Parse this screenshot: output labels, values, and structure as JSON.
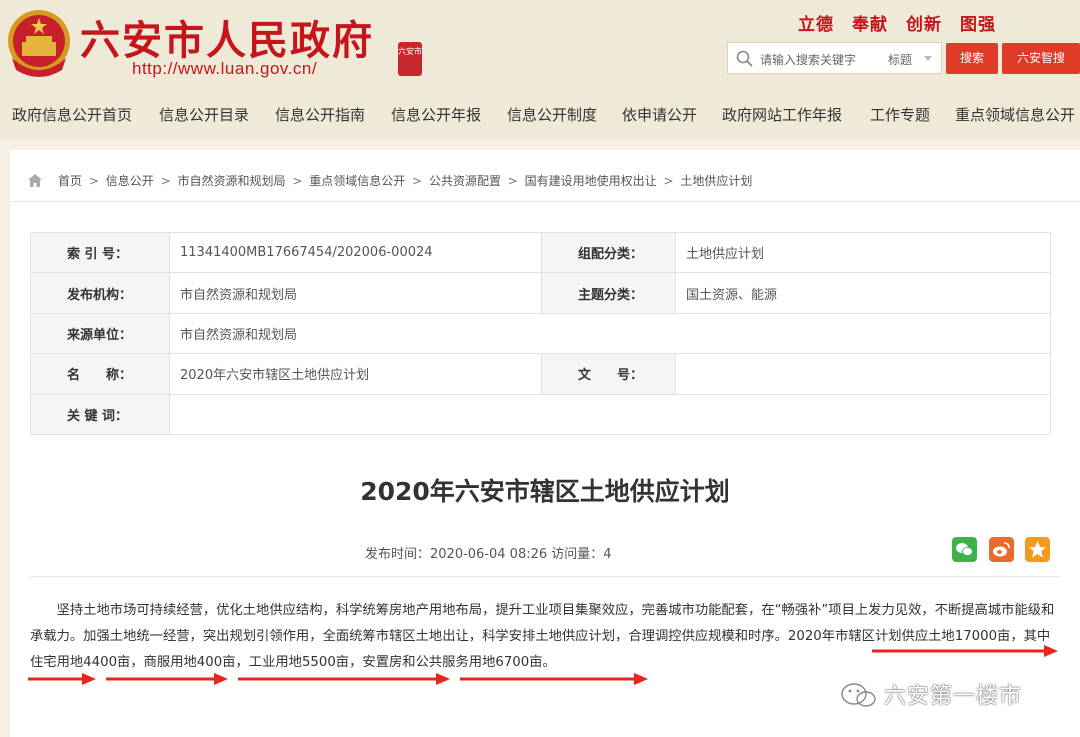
{
  "header": {
    "site_title": "六安市人民政府",
    "site_url": "http://www.luan.gov.cn/",
    "seal_text": "六安市",
    "slogan": "立德　奉献　创新　图强",
    "search": {
      "placeholder": "请输入搜索关键字",
      "scope": "标题",
      "search_button": "搜索",
      "smart_search_button": "六安智搜"
    }
  },
  "nav": {
    "items": [
      "政府信息公开首页",
      "信息公开目录",
      "信息公开指南",
      "信息公开年报",
      "信息公开制度",
      "依申请公开",
      "政府网站工作年报",
      "工作专题",
      "重点领域信息公开"
    ]
  },
  "breadcrumb": {
    "items": [
      "首页",
      "信息公开",
      "市自然资源和规划局",
      "重点领域信息公开",
      "公共资源配置",
      "国有建设用地使用权出让",
      "土地供应计划"
    ],
    "separator": ">"
  },
  "meta": {
    "index_label": "索 引 号：",
    "index_value": "11341400MB17667454/202006-00024",
    "category_label": "组配分类：",
    "category_value": "土地供应计划",
    "publisher_label": "发布机构：",
    "publisher_value": "市自然资源和规划局",
    "topic_label": "主题分类：",
    "topic_value": "国土资源、能源",
    "source_label": "来源单位：",
    "source_value": "市自然资源和规划局",
    "name_label": "名　　称：",
    "name_value": "2020年六安市辖区土地供应计划",
    "docno_label": "文　　号：",
    "docno_value": "",
    "keywords_label": "关 键 词：",
    "keywords_value": ""
  },
  "article": {
    "title": "2020年六安市辖区土地供应计划",
    "info": "发布时间：2020-06-04 08:26  访问量：4",
    "body": "坚持土地市场可持续经营，优化土地供应结构，科学统筹房地产用地布局，提升工业项目集聚效应，完善城市功能配套，在“畅强补”项目上发力见效，不断提高城市能级和承载力。加强土地统一经营，突出规划引领作用，全面统筹市辖区土地出让，科学安排土地供应计划，合理调控供应规模和时序。2020年市辖区计划供应土地17000亩，其中住宅用地4400亩，商服用地400亩，工业用地5500亩，安置房和公共服务用地6700亩。"
  },
  "watermark": {
    "text": "六安第一楼市"
  },
  "colors": {
    "brand_red": "#c4161c",
    "button_red": "#e03a28",
    "header_bg": "#efe9d8",
    "wechat_green": "#3db24b",
    "weibo_orange": "#e86c2d",
    "favorite_orange": "#f29a1b",
    "arrow_red": "#e8261c"
  }
}
